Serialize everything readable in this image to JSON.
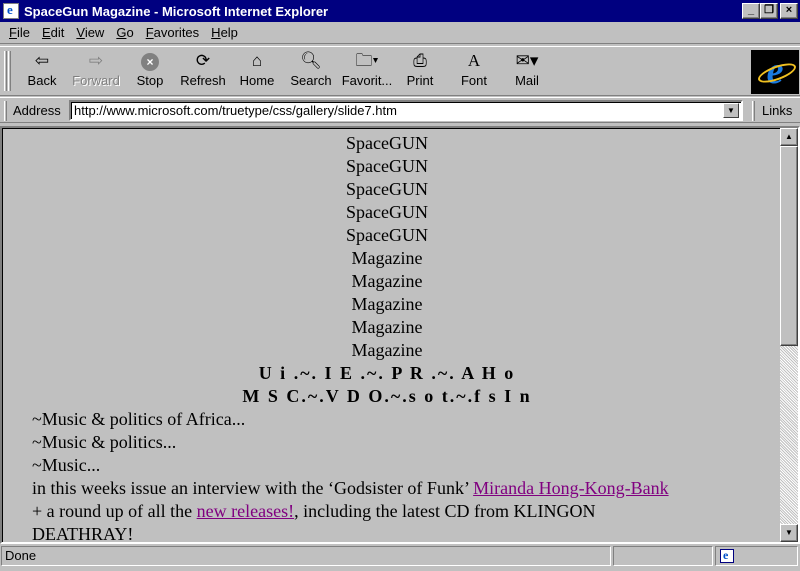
{
  "window": {
    "title": "SpaceGun Magazine - Microsoft Internet Explorer",
    "minimize": "_",
    "restore": "❐",
    "close": "×"
  },
  "menu": {
    "items": [
      {
        "hot": "F",
        "rest": "ile"
      },
      {
        "hot": "E",
        "rest": "dit"
      },
      {
        "hot": "V",
        "rest": "iew"
      },
      {
        "hot": "G",
        "rest": "o"
      },
      {
        "hot": "F",
        "rest": "avorites"
      },
      {
        "hot": "H",
        "rest": "elp"
      }
    ]
  },
  "toolbar": {
    "back": "Back",
    "forward": "Forward",
    "stop": "Stop",
    "refresh": "Refresh",
    "home": "Home",
    "search": "Search",
    "favorites": "Favorit...",
    "print": "Print",
    "font": "Font",
    "mail": "Mail"
  },
  "address": {
    "label": "Address",
    "url": "http://www.microsoft.com/truetype/css/gallery/slide7.htm",
    "links": "Links"
  },
  "page": {
    "spacegun_lines": [
      "SpaceGUN",
      "SpaceGUN",
      "SpaceGUN",
      "SpaceGUN",
      "SpaceGUN"
    ],
    "magazine_lines": [
      "Magazine",
      "Magazine",
      "Magazine",
      "Magazine",
      "Magazine"
    ],
    "bold_line_1": "U i .~. I E .~. P R .~. A H o",
    "bold_line_2": "M S C.~.V D O.~.s o t.~.f s I n",
    "line_1": "~Music & politics of Africa...",
    "line_2": "~Music & politics...",
    "line_3": "~Music...",
    "interview_text": "in this weeks issue an interview with the ‘Godsister of Funk’ ",
    "interview_link": "Miranda Hong-Kong-Bank",
    "roundup_prefix": "+ a round up of all the ",
    "roundup_link": "new releases!",
    "roundup_suffix": ", including the latest CD from KLINGON",
    "roundup_last": "DEATHRAY!"
  },
  "status": {
    "text": "Done"
  }
}
